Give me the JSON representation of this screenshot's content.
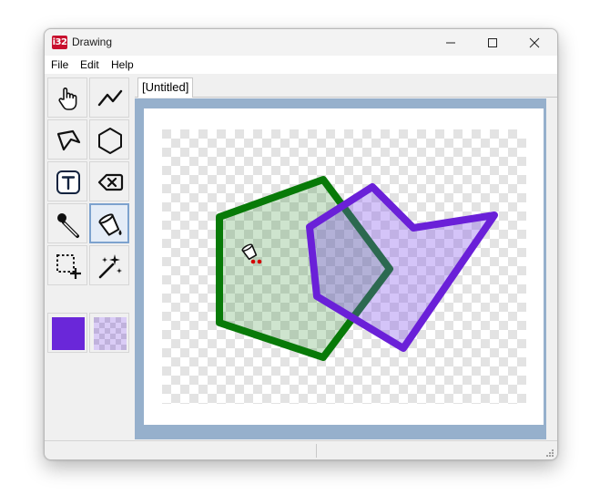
{
  "window": {
    "title": "Drawing",
    "app_icon_text": "i32"
  },
  "menu": [
    {
      "label": "File"
    },
    {
      "label": "Edit"
    },
    {
      "label": "Help"
    }
  ],
  "tools": [
    {
      "name": "pan",
      "icon": "hand-icon",
      "selected": false
    },
    {
      "name": "polyline",
      "icon": "polyline-icon",
      "selected": false
    },
    {
      "name": "freeform-shape",
      "icon": "freeform-shape-icon",
      "selected": false
    },
    {
      "name": "polygon",
      "icon": "hexagon-icon",
      "selected": false
    },
    {
      "name": "text",
      "icon": "text-icon",
      "selected": false
    },
    {
      "name": "delete",
      "icon": "delete-icon",
      "selected": false
    },
    {
      "name": "color-picker",
      "icon": "eyedropper-icon",
      "selected": false
    },
    {
      "name": "fill",
      "icon": "paint-bucket-icon",
      "selected": true
    },
    {
      "name": "select",
      "icon": "selection-icon",
      "selected": false
    },
    {
      "name": "magic",
      "icon": "magic-wand-icon",
      "selected": false
    }
  ],
  "colors": {
    "primary": "#6a27d9",
    "secondary": "#c9b4ee",
    "green_stroke": "#087a08",
    "green_fill": "rgba(8,122,8,0.2)",
    "purple_stroke": "#6a20d8",
    "purple_fill": "rgba(122,70,232,0.32)",
    "workspace": "#96b0cc"
  },
  "tabs": [
    {
      "label": "[Untitled]"
    }
  ],
  "statusbar": {
    "left": "",
    "right": ""
  }
}
